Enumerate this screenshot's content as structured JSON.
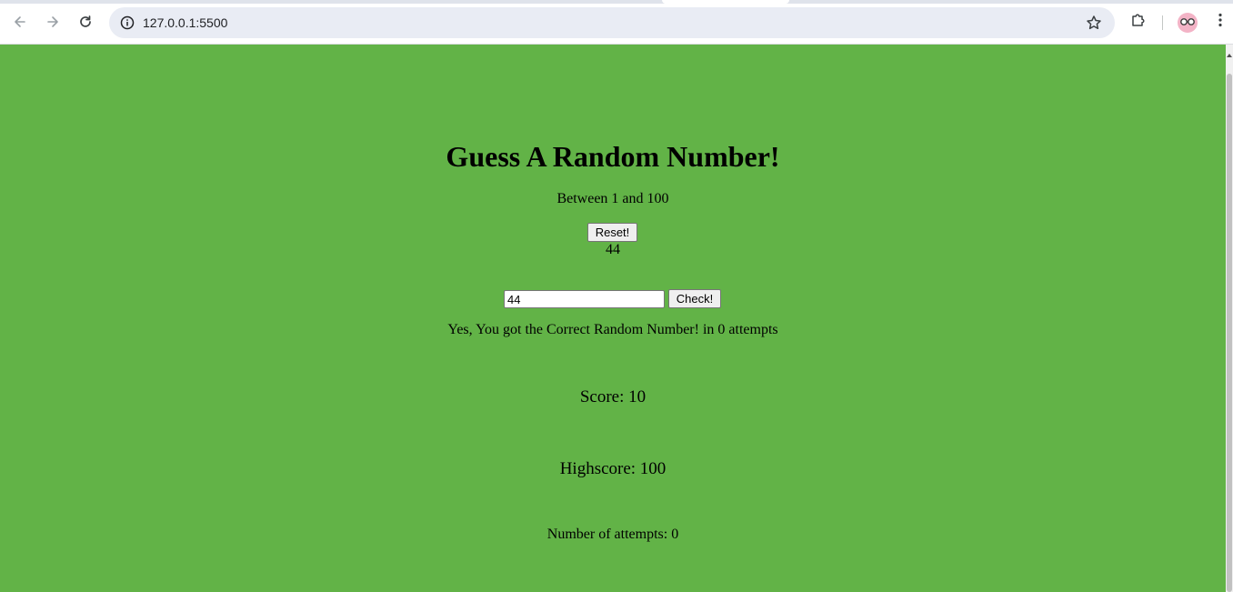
{
  "browser": {
    "url": "127.0.0.1:5500",
    "icons": {
      "back": "arrow-left",
      "forward": "arrow-right",
      "reload": "reload",
      "site_info": "info-circle",
      "bookmark": "star-outline",
      "extensions": "puzzle-piece",
      "profile": "avatar-glasses",
      "menu": "three-dots-vertical"
    },
    "colors": {
      "omnibox_bg": "#e9ecf4",
      "avatar_bg": "#f3b3c6"
    }
  },
  "page": {
    "background_color": "#62b347",
    "title": "Guess A Random Number!",
    "subtitle": "Between 1 and 100",
    "reset_label": "Reset!",
    "secret_number": "44",
    "guess_input_value": "44",
    "check_label": "Check!",
    "message": "Yes, You got the Correct Random Number! in 0 attempts",
    "score_text": "Score: 10",
    "highscore_text": "Highscore: 100",
    "attempts_text": "Number of attempts: 0"
  }
}
